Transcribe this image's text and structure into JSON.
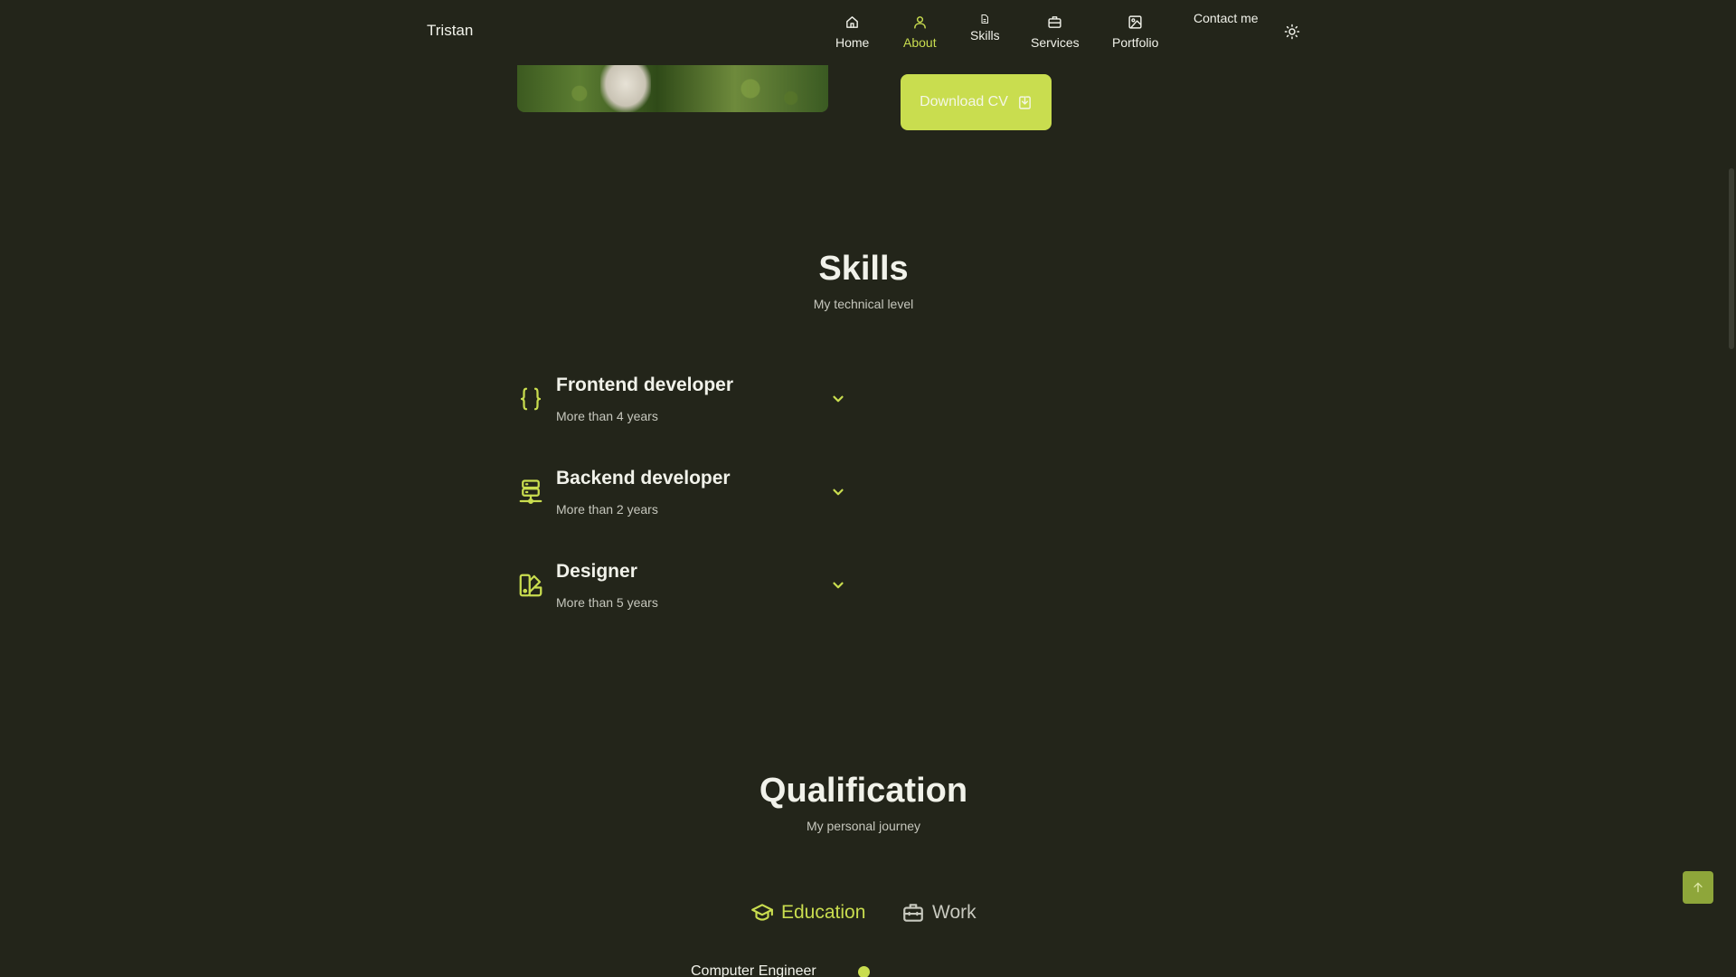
{
  "header": {
    "logo": "Tristan",
    "nav": [
      {
        "label": "Home",
        "icon": "home-icon",
        "active": false
      },
      {
        "label": "About",
        "icon": "user-icon",
        "active": true
      },
      {
        "label": "Skills",
        "icon": "file-icon",
        "active": false
      },
      {
        "label": "Services",
        "icon": "briefcase-icon",
        "active": false
      },
      {
        "label": "Portfolio",
        "icon": "image-icon",
        "active": false
      },
      {
        "label": "Contact me",
        "icon": "",
        "active": false
      }
    ],
    "theme_icon": "sun-icon"
  },
  "hero": {
    "download_label": "Download CV",
    "download_icon": "download-icon"
  },
  "skills": {
    "title": "Skills",
    "subtitle": "My technical level",
    "items": [
      {
        "title": "Frontend developer",
        "subtitle": "More than 4 years",
        "icon": "braces-icon"
      },
      {
        "title": "Backend developer",
        "subtitle": "More than 2 years",
        "icon": "server-icon"
      },
      {
        "title": "Designer",
        "subtitle": "More than 5 years",
        "icon": "swatchbook-icon"
      }
    ]
  },
  "qualification": {
    "title": "Qualification",
    "subtitle": "My personal journey",
    "tabs": [
      {
        "label": "Education",
        "icon": "graduation-cap-icon",
        "active": true
      },
      {
        "label": "Work",
        "icon": "briefcase-icon",
        "active": false
      }
    ],
    "timeline": [
      {
        "title": "Computer Engineer"
      }
    ]
  },
  "colors": {
    "background": "#23251a",
    "accent": "#c9dd4f",
    "text": "#f1f2ea",
    "muted": "#c6c7bd"
  }
}
